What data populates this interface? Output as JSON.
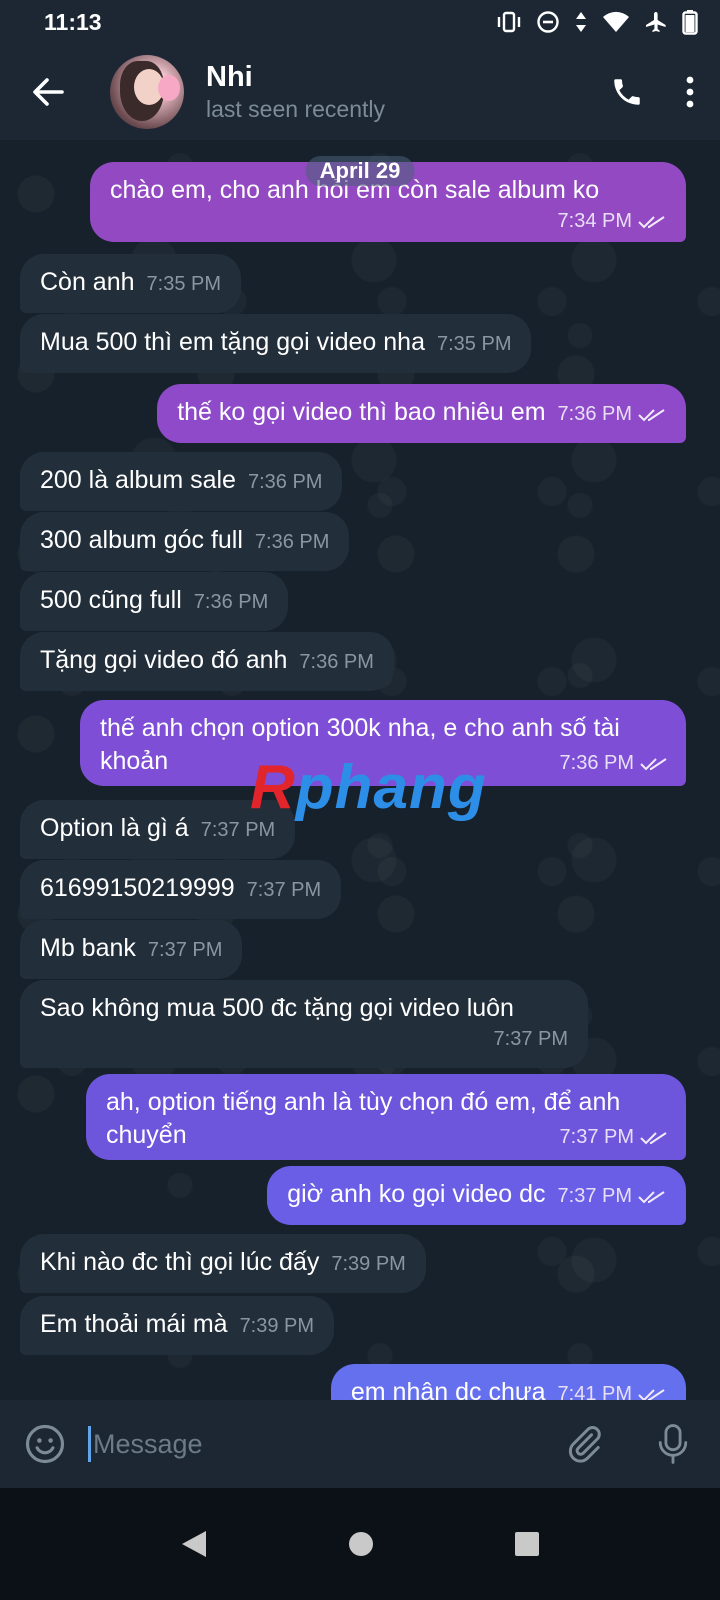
{
  "status_bar": {
    "time": "11:13"
  },
  "header": {
    "name": "Nhi",
    "status": "last seen recently",
    "icons": [
      "back-arrow-icon",
      "phone-icon",
      "more-vert-icon"
    ]
  },
  "chat": {
    "date_chip": "April 29",
    "messages": [
      {
        "dir": "out",
        "text": "chào em, cho anh hỏi em còn sale album ko",
        "time": "7:34 PM"
      },
      {
        "dir": "in",
        "text": "Còn anh",
        "time": "7:35 PM"
      },
      {
        "dir": "in",
        "text": "Mua 500 thì em tặng gọi video nha",
        "time": "7:35 PM"
      },
      {
        "dir": "out",
        "text": "thế ko gọi video thì bao nhiêu em",
        "time": "7:36 PM"
      },
      {
        "dir": "in",
        "text": "200 là album sale",
        "time": "7:36 PM"
      },
      {
        "dir": "in",
        "text": "300 album góc full",
        "time": "7:36 PM"
      },
      {
        "dir": "in",
        "text": "500 cũng full",
        "time": "7:36 PM"
      },
      {
        "dir": "in",
        "text": "Tặng gọi video đó anh",
        "time": "7:36 PM"
      },
      {
        "dir": "out",
        "text": "thế anh chọn option 300k nha, e cho anh số tài khoản",
        "time": "7:36 PM"
      },
      {
        "dir": "in",
        "text": "Option là gì á",
        "time": "7:37 PM"
      },
      {
        "dir": "in",
        "text": "61699150219999",
        "time": "7:37 PM"
      },
      {
        "dir": "in",
        "text": "Mb bank",
        "time": "7:37 PM"
      },
      {
        "dir": "in",
        "text": "Sao không mua 500 đc tặng gọi video luôn",
        "time": "7:37 PM"
      },
      {
        "dir": "out",
        "text": "ah, option tiếng anh là tùy chọn đó em, để anh chuyển",
        "time": "7:37 PM"
      },
      {
        "dir": "out",
        "text": "giờ anh ko gọi video dc",
        "time": "7:37 PM"
      },
      {
        "dir": "in",
        "text": "Khi nào đc thì gọi lúc đấy",
        "time": "7:39 PM"
      },
      {
        "dir": "in",
        "text": "Em thoải mái mà",
        "time": "7:39 PM"
      },
      {
        "dir": "out",
        "text": "em nhận dc chưa",
        "time": "7:41 PM"
      }
    ],
    "watermark": {
      "part1": "R",
      "part2": "phang"
    }
  },
  "composer": {
    "placeholder": "Message"
  },
  "colors": {
    "bg": "#17212b",
    "bar": "#1c2733",
    "bubble_in": "#222e3a",
    "bubble_out_purple": "#8a4fc6",
    "bubble_out_violet": "#6e56e0",
    "bubble_out_blue": "#6a6ef0",
    "caret": "#5ea6e8"
  }
}
